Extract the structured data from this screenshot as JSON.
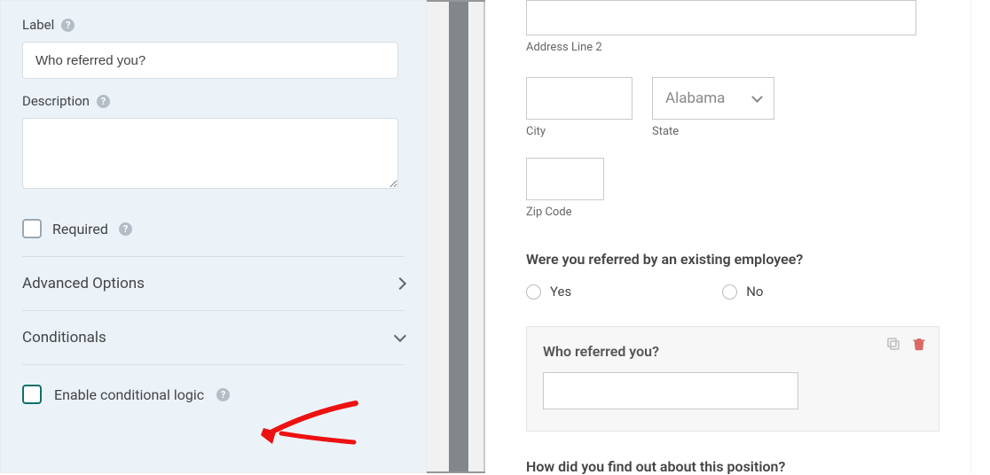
{
  "left": {
    "label_title": "Label",
    "label_value": "Who referred you?",
    "description_title": "Description",
    "description_value": "",
    "required_label": "Required",
    "advanced_options": "Advanced Options",
    "conditionals": "Conditionals",
    "enable_conditional": "Enable conditional logic"
  },
  "right": {
    "addr2_label": "Address Line 2",
    "city_label": "City",
    "state_label": "State",
    "state_value": "Alabama",
    "zip_label": "Zip Code",
    "q_referred": "Were you referred by an existing employee?",
    "opt_yes": "Yes",
    "opt_no": "No",
    "who_referred": "Who referred you?",
    "q_howfind": "How did you find out about this position?"
  }
}
